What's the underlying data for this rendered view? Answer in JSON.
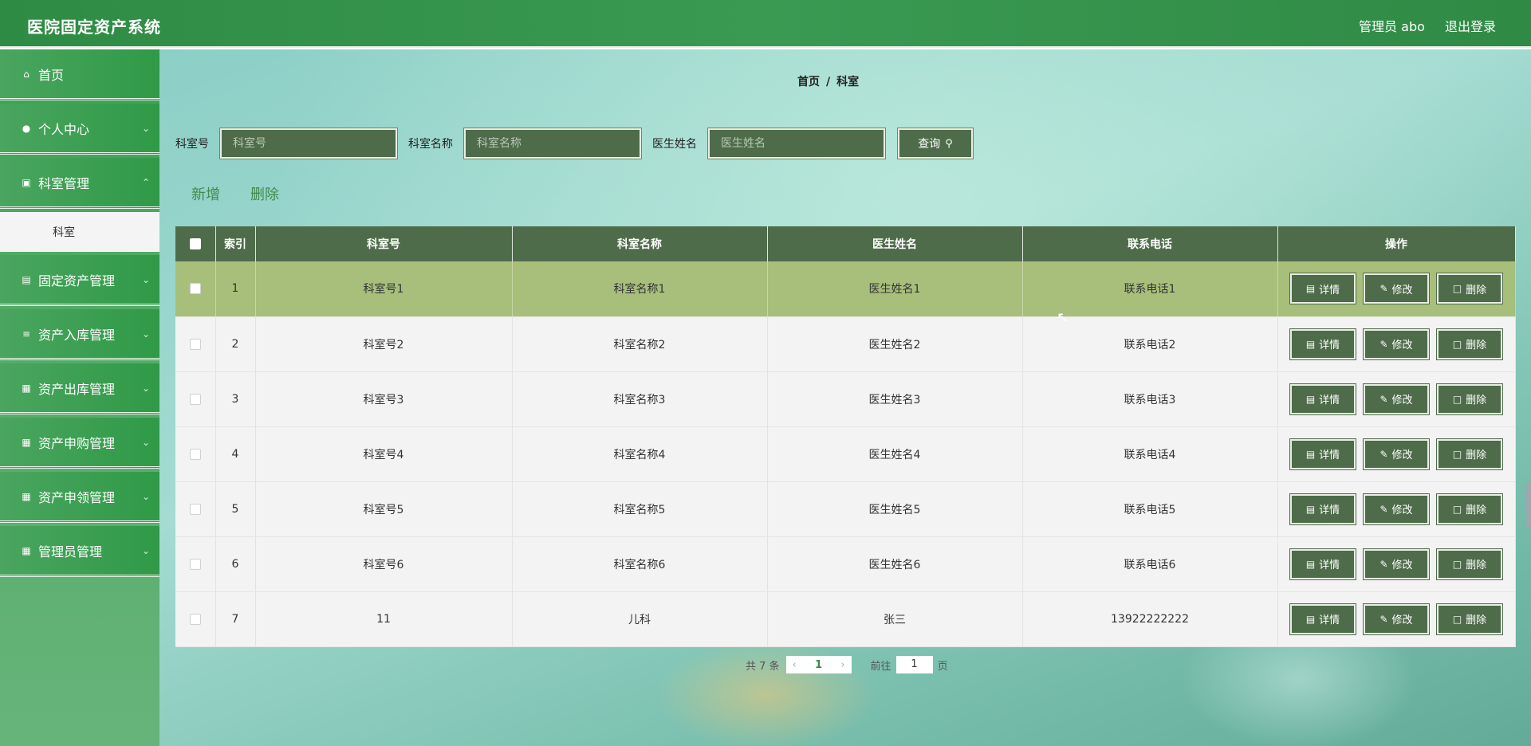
{
  "header": {
    "title": "医院固定资产系统",
    "user": "管理员 abo",
    "logout": "退出登录"
  },
  "sidebar": {
    "items": [
      {
        "label": "首页",
        "icon": "home-icon",
        "glyph": "⌂",
        "chev": ""
      },
      {
        "label": "个人中心",
        "icon": "user-icon",
        "glyph": "●",
        "chev": "⌄"
      },
      {
        "label": "科室管理",
        "icon": "clipboard-icon",
        "glyph": "▣",
        "chev": "⌃"
      },
      {
        "label": "固定资产管理",
        "icon": "document-icon",
        "glyph": "▤",
        "chev": "⌄"
      },
      {
        "label": "资产入库管理",
        "icon": "list-icon",
        "glyph": "≡",
        "chev": "⌄"
      },
      {
        "label": "资产出库管理",
        "icon": "grid-icon",
        "glyph": "▦",
        "chev": "⌄"
      },
      {
        "label": "资产申购管理",
        "icon": "grid-icon",
        "glyph": "▦",
        "chev": "⌄"
      },
      {
        "label": "资产申领管理",
        "icon": "grid-icon",
        "glyph": "▦",
        "chev": "⌄"
      },
      {
        "label": "管理员管理",
        "icon": "grid-icon",
        "glyph": "▦",
        "chev": "⌄"
      }
    ],
    "submenu": "科室"
  },
  "breadcrumb": {
    "home": "首页",
    "sep": "/",
    "current": "科室"
  },
  "search": {
    "dept_no_label": "科室号",
    "dept_no_placeholder": "科室号",
    "dept_name_label": "科室名称",
    "dept_name_placeholder": "科室名称",
    "doctor_label": "医生姓名",
    "doctor_placeholder": "医生姓名",
    "query_label": "查询"
  },
  "actions": {
    "add": "新增",
    "delete": "删除"
  },
  "table": {
    "headers": [
      "索引",
      "科室号",
      "科室名称",
      "医生姓名",
      "联系电话",
      "操作"
    ],
    "rows": [
      [
        "1",
        "科室号1",
        "科室名称1",
        "医生姓名1",
        "联系电话1"
      ],
      [
        "2",
        "科室号2",
        "科室名称2",
        "医生姓名2",
        "联系电话2"
      ],
      [
        "3",
        "科室号3",
        "科室名称3",
        "医生姓名3",
        "联系电话3"
      ],
      [
        "4",
        "科室号4",
        "科室名称4",
        "医生姓名4",
        "联系电话4"
      ],
      [
        "5",
        "科室号5",
        "科室名称5",
        "医生姓名5",
        "联系电话5"
      ],
      [
        "6",
        "科室号6",
        "科室名称6",
        "医生姓名6",
        "联系电话6"
      ],
      [
        "7",
        "11",
        "儿科",
        "张三",
        "13922222222"
      ]
    ],
    "buttons": {
      "detail": "详情",
      "edit": "修改",
      "delete": "删除"
    }
  },
  "pagination": {
    "total": "共 7 条",
    "page": "1",
    "goto_prefix": "前往",
    "goto_value": "1",
    "goto_suffix": "页"
  },
  "colors": {
    "primary": "#4e6c4a",
    "sidebar": "#2f9a47",
    "highlight_row": "#a7bf7a"
  }
}
